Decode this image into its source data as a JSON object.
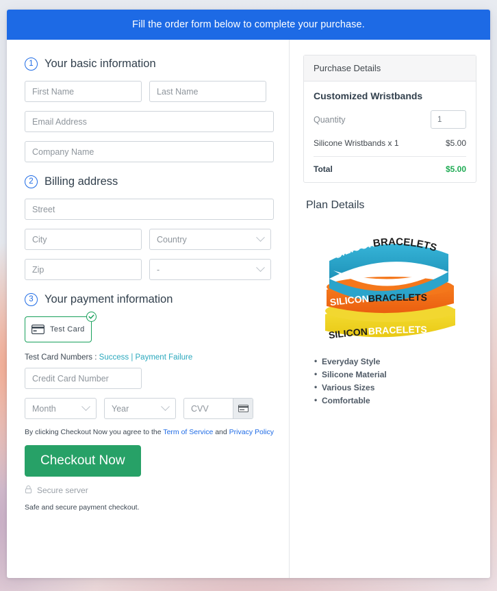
{
  "banner": {
    "text": "Fill the order form below to complete your purchase."
  },
  "steps": {
    "basic": {
      "number": "1",
      "title": "Your basic information"
    },
    "billing": {
      "number": "2",
      "title": "Billing address"
    },
    "payment": {
      "number": "3",
      "title": "Your payment information"
    }
  },
  "fields": {
    "first_name": {
      "placeholder": "First Name",
      "value": ""
    },
    "last_name": {
      "placeholder": "Last Name",
      "value": ""
    },
    "email": {
      "placeholder": "Email Address",
      "value": ""
    },
    "company": {
      "placeholder": "Company Name",
      "value": ""
    },
    "street": {
      "placeholder": "Street",
      "value": ""
    },
    "city": {
      "placeholder": "City",
      "value": ""
    },
    "country": {
      "placeholder": "Country",
      "value": "Country"
    },
    "zip": {
      "placeholder": "Zip",
      "value": ""
    },
    "state": {
      "placeholder": "-",
      "value": "-"
    },
    "card_number": {
      "placeholder": "Credit Card Number",
      "value": ""
    },
    "month": {
      "placeholder": "Month",
      "value": "Month"
    },
    "year": {
      "placeholder": "Year",
      "value": "Year"
    },
    "cvv": {
      "placeholder": "CVV",
      "value": ""
    }
  },
  "payment": {
    "test_card_label": "Test  Card",
    "test_numbers_prefix": "Test Card Numbers : ",
    "link_success": "Success",
    "link_separator": " | ",
    "link_failure": "Payment Failure",
    "terms_prefix": "By clicking Checkout Now you agree to the ",
    "terms_link": "Term of Service",
    "terms_middle": " and ",
    "privacy_link": "Privacy Policy",
    "checkout_label": "Checkout Now",
    "secure_server": "Secure server",
    "safe_note": "Safe and secure payment checkout."
  },
  "purchase": {
    "header": "Purchase Details",
    "product_title": "Customized Wristbands",
    "quantity_label": "Quantity",
    "quantity_value": "1",
    "line_item_label": "Silicone Wristbands x 1",
    "line_item_price": "$5.00",
    "total_label": "Total",
    "total_price": "$5.00"
  },
  "plan": {
    "title": "Plan Details",
    "image_alt": "silicone-wristbands-stack",
    "band_text_light": "SILICON",
    "band_text_dark": "BRACELETS",
    "features": [
      "Everyday Style",
      "Silicone Material",
      "Various Sizes",
      "Comfortable"
    ]
  },
  "colors": {
    "banner_blue": "#1d6ae5",
    "link_blue": "#1d6ae5",
    "link_teal": "#2aa8bd",
    "checkout_green": "#27a167",
    "total_green": "#1fab54",
    "testcard_green": "#17a05b",
    "band_blue": "#2fa9ce",
    "band_orange": "#f2701a",
    "band_yellow": "#f4d921"
  }
}
